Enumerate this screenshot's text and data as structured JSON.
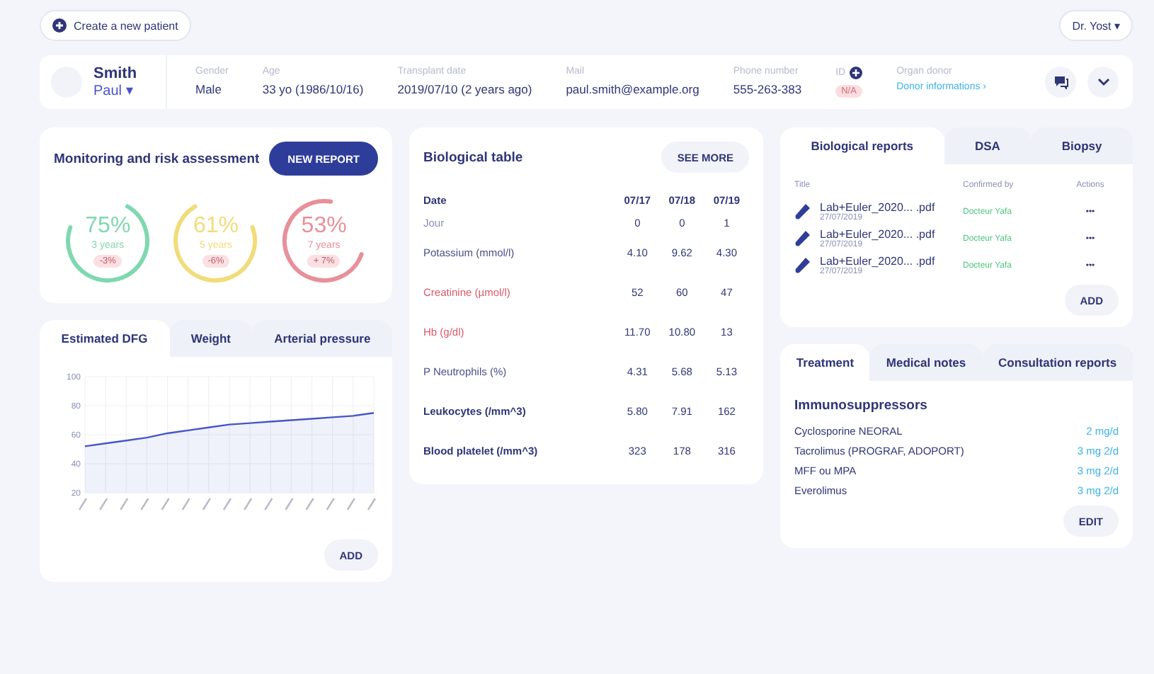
{
  "top_bar": {
    "create_button": "Create a new patient",
    "user_menu": "Dr. Yost ▾"
  },
  "patient": {
    "last_name": "Smith",
    "first_name": "Paul ▾",
    "fields": [
      {
        "label": "Gender",
        "value": "Male",
        "kind": "text"
      },
      {
        "label": "Age",
        "value": "33 yo (1986/10/16)",
        "kind": "text"
      },
      {
        "label": "Transplant date",
        "value": "2019/07/10 (2 years ago)",
        "kind": "text"
      },
      {
        "label": "Mail",
        "value": "paul.smith@example.org",
        "kind": "text"
      },
      {
        "label": "Phone number",
        "value": "555-263-383",
        "kind": "text"
      },
      {
        "label": "ID",
        "value": "N/A",
        "kind": "badge"
      },
      {
        "label": "Organ donor",
        "value": "Donor informations ›",
        "kind": "link"
      }
    ]
  },
  "monitoring": {
    "title": "Monitoring and risk assessment",
    "button": "NEW REPORT",
    "gauges": [
      {
        "percent": "75%",
        "period": "3 years",
        "delta": "-3%",
        "color": "#7fd8b0"
      },
      {
        "percent": "61%",
        "period": "5 years",
        "delta": "-6%",
        "color": "#f2dc7a"
      },
      {
        "percent": "53%",
        "period": "7 years",
        "delta": "+ 7%",
        "color": "#e8909a"
      }
    ]
  },
  "curves": {
    "tabs": [
      {
        "label": "Estimated DFG",
        "selected": true
      },
      {
        "label": "Weight",
        "selected": false
      },
      {
        "label": "Arterial pressure",
        "selected": false
      }
    ],
    "chart_data": {
      "type": "area",
      "categories": [
        null,
        null,
        null,
        null,
        null,
        null,
        null,
        null,
        null,
        null,
        null,
        null,
        null,
        null,
        null
      ],
      "ylim": [
        20,
        100
      ],
      "grid": true,
      "yticks": [
        20,
        40,
        60,
        80,
        100
      ],
      "series": [
        {
          "color": "#4655c8",
          "values": [
            52,
            54,
            56,
            58,
            61,
            63,
            65,
            67,
            68,
            69,
            70,
            71,
            72,
            73,
            75
          ]
        }
      ]
    },
    "button": "ADD"
  },
  "bio_table": {
    "title": "Biological table",
    "button": "SEE MORE",
    "header": "Date",
    "columns": [
      "07/17",
      "07/18",
      "07/19"
    ],
    "rows": [
      {
        "label": "Jour",
        "kind": "light",
        "values": [
          "0",
          "0",
          "1"
        ]
      },
      {
        "label": "Potassium (mmol/l)",
        "kind": "normal",
        "values": [
          "4.10",
          "9.62",
          "4.30"
        ]
      },
      {
        "label": "Creatinine (µmol/l)",
        "kind": "alert",
        "values": [
          "52",
          "60",
          "47"
        ]
      },
      {
        "label": "Hb (g/dl)",
        "kind": "alert",
        "values": [
          "11.70",
          "10.80",
          "13"
        ]
      },
      {
        "label": "P Neutrophils (%)",
        "kind": "normal",
        "values": [
          "4.31",
          "5.68",
          "5.13"
        ]
      },
      {
        "label": "Leukocytes (/mm^3)",
        "kind": "bold",
        "values": [
          "5.80",
          "7.91",
          "162"
        ]
      },
      {
        "label": "Blood platelet (/mm^3)",
        "kind": "bold",
        "values": [
          "323",
          "178",
          "316"
        ]
      }
    ]
  },
  "reports": {
    "tabs": [
      {
        "label": "Biological reports",
        "selected": true
      },
      {
        "label": "DSA",
        "selected": false
      },
      {
        "label": "Biopsy",
        "selected": false
      }
    ],
    "columns": [
      "Title",
      "Confirmed by",
      "Actions"
    ],
    "rows": [
      {
        "file": "Lab+Euler_2020... .pdf",
        "date": "27/07/2019",
        "confirmed_by": "Docteur Yafa",
        "actions": "•••"
      },
      {
        "file": "Lab+Euler_2020... .pdf",
        "date": "27/07/2019",
        "confirmed_by": "Docteur Yafa",
        "actions": "•••"
      },
      {
        "file": "Lab+Euler_2020... .pdf",
        "date": "27/07/2019",
        "confirmed_by": "Docteur Yafa",
        "actions": "•••"
      }
    ],
    "button": "ADD"
  },
  "treatment": {
    "tabs": [
      {
        "label": "Treatment",
        "selected": true
      },
      {
        "label": "Medical notes",
        "selected": false
      },
      {
        "label": "Consultation reports",
        "selected": false
      }
    ],
    "section": "Immunosuppressors",
    "medications": [
      {
        "name": "Cyclosporine NEORAL",
        "dose": "2 mg/d"
      },
      {
        "name": "Tacrolimus (PROGRAF, ADOPORT)",
        "dose": "3 mg 2/d"
      },
      {
        "name": "MFF ou MPA",
        "dose": "3 mg 2/d"
      },
      {
        "name": "Everolimus",
        "dose": "3 mg 2/d"
      }
    ],
    "button": "EDIT"
  }
}
